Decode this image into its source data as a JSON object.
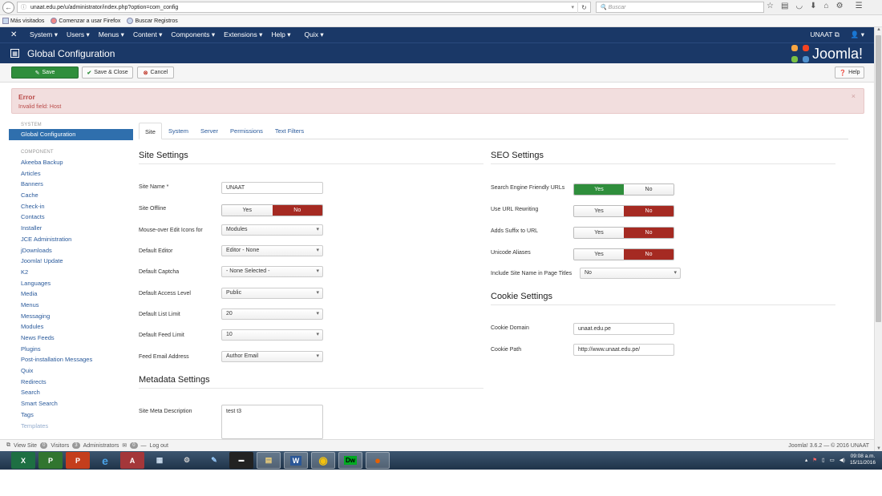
{
  "browser": {
    "url": "unaat.edu.pe/u/administrator/index.php?option=com_config",
    "search_placeholder": "Buscar",
    "bookmarks": [
      "Más visitados",
      "Comenzar a usar Firefox",
      "Buscar Registros"
    ]
  },
  "topnav": {
    "menus": [
      "System ▾",
      "Users ▾",
      "Menus ▾",
      "Content ▾",
      "Components ▾",
      "Extensions ▾",
      "Help ▾",
      "Quix ▾"
    ],
    "site_link": "UNAAT ⧉",
    "user_menu": "👤 ▾"
  },
  "header": {
    "title": "Global Configuration",
    "brand": "Joomla!"
  },
  "toolbar": {
    "save": "Save",
    "save_close": "Save & Close",
    "cancel": "Cancel",
    "help": "Help"
  },
  "alert": {
    "heading": "Error",
    "message": "Invalid field:  Host",
    "close": "×"
  },
  "sidebar": {
    "system_heading": "SYSTEM",
    "active": "Global Configuration",
    "component_heading": "COMPONENT",
    "items": [
      "Akeeba Backup",
      "Articles",
      "Banners",
      "Cache",
      "Check-in",
      "Contacts",
      "Installer",
      "JCE Administration",
      "jDownloads",
      "Joomla! Update",
      "K2",
      "Languages",
      "Media",
      "Menus",
      "Messaging",
      "Modules",
      "News Feeds",
      "Plugins",
      "Post-installation Messages",
      "Quix",
      "Redirects",
      "Search",
      "Smart Search",
      "Tags",
      "Templates"
    ]
  },
  "tabs": [
    "Site",
    "System",
    "Server",
    "Permissions",
    "Text Filters"
  ],
  "site_settings": {
    "title": "Site Settings",
    "site_name_label": "Site Name *",
    "site_name_value": "UNAAT",
    "site_offline_label": "Site Offline",
    "mouseover_label": "Mouse-over Edit Icons for",
    "mouseover_value": "Modules",
    "editor_label": "Default Editor",
    "editor_value": "Editor - None",
    "captcha_label": "Default Captcha",
    "captcha_value": "- None Selected -",
    "access_label": "Default Access Level",
    "access_value": "Public",
    "list_limit_label": "Default List Limit",
    "list_limit_value": "20",
    "feed_limit_label": "Default Feed Limit",
    "feed_limit_value": "10",
    "feed_email_label": "Feed Email Address",
    "feed_email_value": "Author Email"
  },
  "metadata": {
    "title": "Metadata Settings",
    "meta_desc_label": "Site Meta Description",
    "meta_desc_value": "test t3"
  },
  "seo": {
    "title": "SEO Settings",
    "sef_label": "Search Engine Friendly URLs",
    "rewrite_label": "Use URL Rewriting",
    "suffix_label": "Adds Suffix to URL",
    "unicode_label": "Unicode Aliases",
    "sitename_label": "Include Site Name in Page Titles",
    "sitename_value": "No"
  },
  "toggle": {
    "yes": "Yes",
    "no": "No"
  },
  "cookie": {
    "title": "Cookie Settings",
    "domain_label": "Cookie Domain",
    "domain_value": "unaat.edu.pe",
    "path_label": "Cookie Path",
    "path_value": "http://www.unaat.edu.pe/"
  },
  "statusbar": {
    "view_site": "View Site",
    "visitors_count": "0",
    "visitors_label": "Visitors",
    "admins_count": "3",
    "admins_label": "Administrators",
    "messages_count": "0",
    "logout": "Log out",
    "version": "Joomla! 3.6.2 — © 2016 UNAAT"
  },
  "taskbar": {
    "time": "09:08 a.m.",
    "date": "15/11/2016"
  },
  "colors": {
    "nav": "#1a3867",
    "save_green": "#2f8e3c",
    "no_red": "#a52a22",
    "link_blue": "#2a5a9b",
    "alert_bg": "#f2dede"
  }
}
